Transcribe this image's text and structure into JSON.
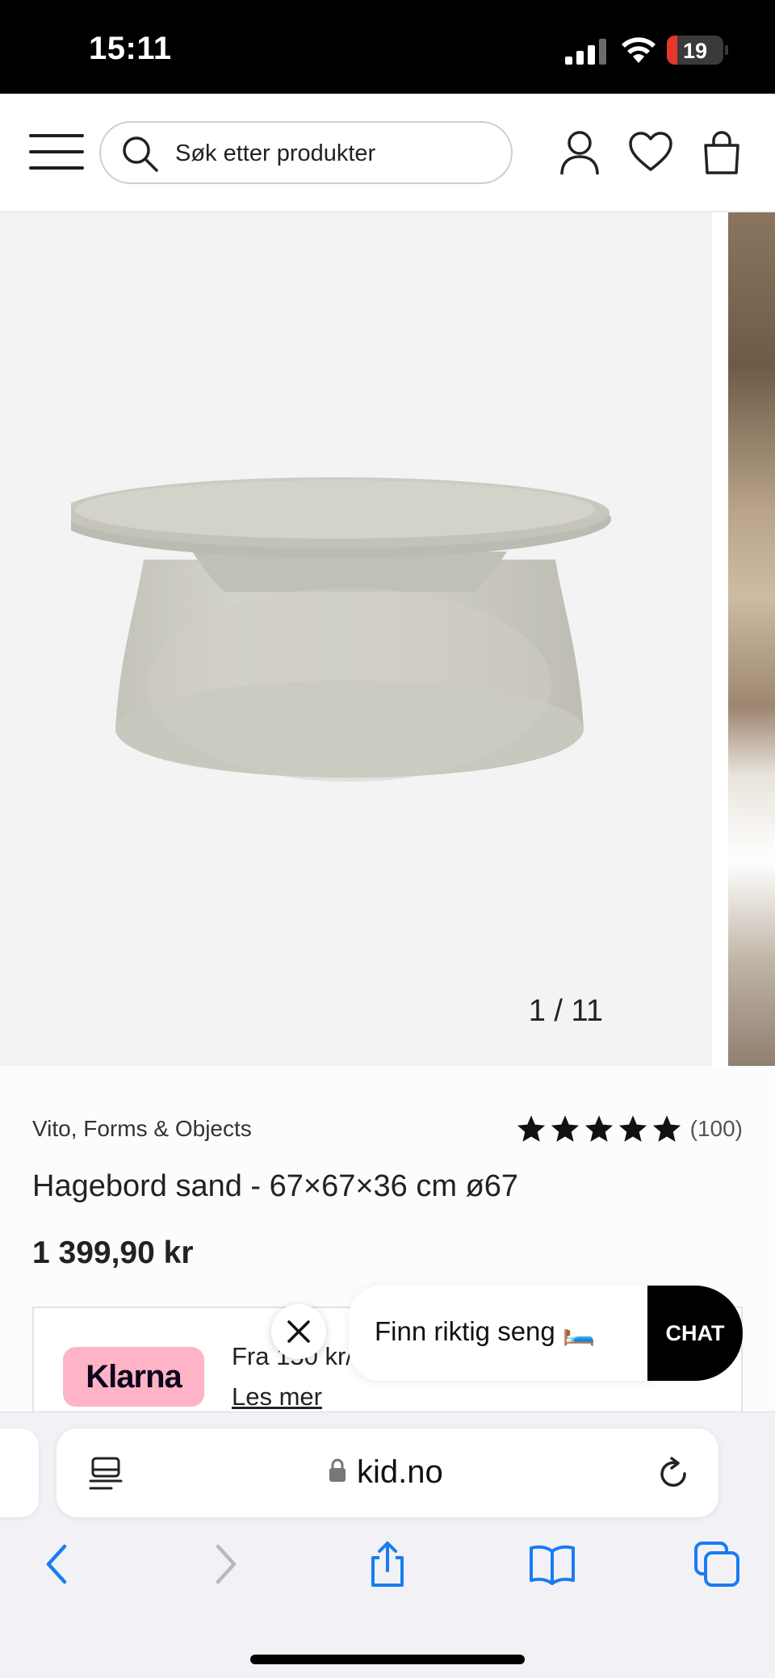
{
  "status_bar": {
    "time": "15:11",
    "battery_level": 19,
    "battery_fill": 0.19,
    "battery_color": "#e5372b"
  },
  "header": {
    "search_placeholder": "Søk etter produkter",
    "icons": [
      "menu-icon",
      "search-icon",
      "user-icon",
      "heart-icon",
      "bag-icon"
    ]
  },
  "gallery": {
    "counter": "1 / 11",
    "current": 1,
    "total": 11
  },
  "product": {
    "brand": "Vito, Forms & Objects",
    "rating_stars": 5,
    "review_count": "(100)",
    "title": "Hagebord sand - 67×67×36 cm ø67",
    "price": "1 399,90 kr"
  },
  "klarna": {
    "logo_text": "Klarna",
    "text": "Fra 150 kr/",
    "link": "Les mer",
    "logo_color": "#ffb3c7"
  },
  "chat": {
    "message": "Finn riktig seng 🛏️",
    "button_label": "CHAT"
  },
  "browser": {
    "domain": "kid.no",
    "accent": "#1a7cf3"
  }
}
